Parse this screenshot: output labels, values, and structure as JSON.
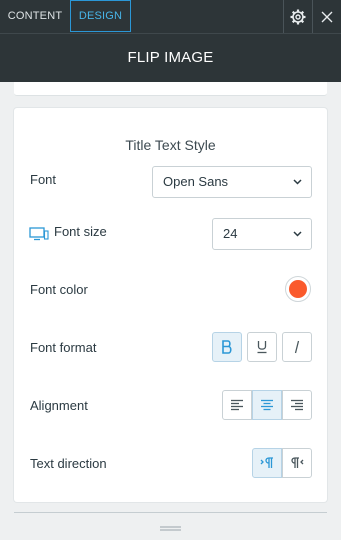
{
  "tabs": {
    "content": "CONTENT",
    "design": "DESIGN"
  },
  "panel_title": "FLIP IMAGE",
  "section_title": "Title Text Style",
  "font": {
    "label": "Font",
    "value": "Open Sans"
  },
  "font_size": {
    "label": "Font size",
    "value": "24"
  },
  "font_color": {
    "label": "Font color",
    "value": "#fa5a2c"
  },
  "font_format": {
    "label": "Font format",
    "bold_active": true
  },
  "alignment": {
    "label": "Alignment",
    "selected": "center"
  },
  "text_direction": {
    "label": "Text direction",
    "selected": "ltr"
  },
  "colors": {
    "accent": "#2b97d6",
    "header_bg": "#2d3538"
  }
}
